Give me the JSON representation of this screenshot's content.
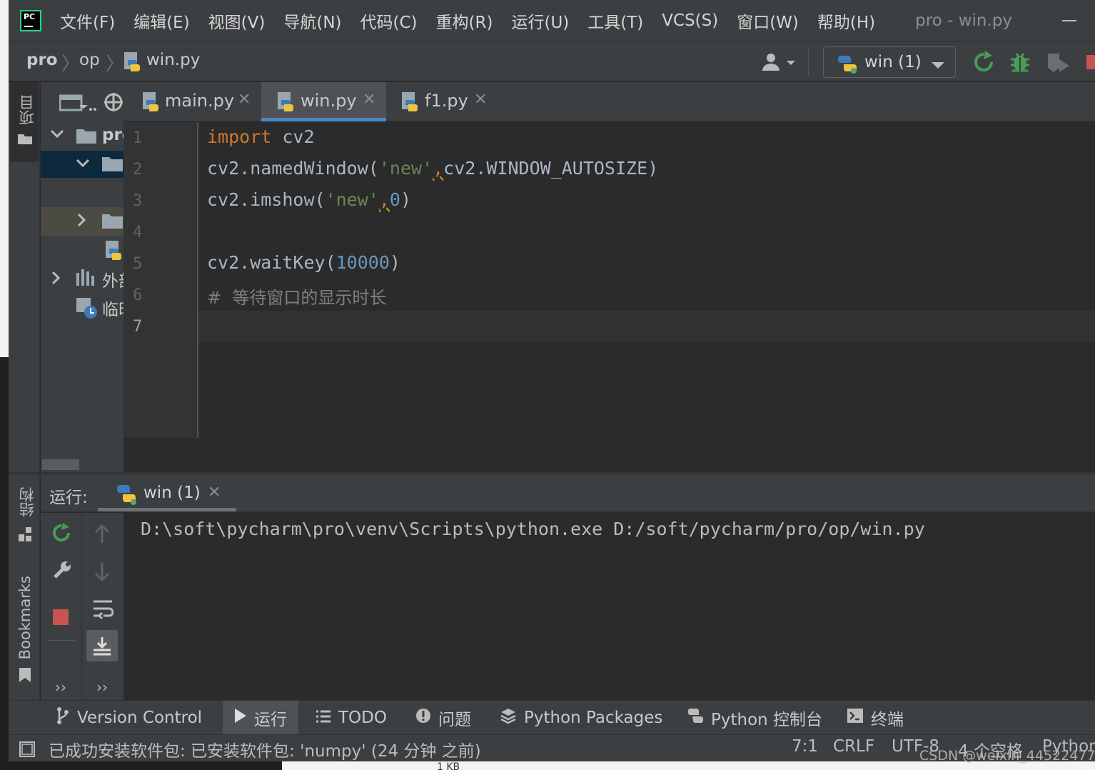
{
  "app": {
    "logo_text": "PC",
    "window_title": "pro - win.py"
  },
  "menu": [
    "文件(F)",
    "编辑(E)",
    "视图(V)",
    "导航(N)",
    "代码(C)",
    "重构(R)",
    "运行(U)",
    "工具(T)",
    "VCS(S)",
    "窗口(W)",
    "帮助(H)"
  ],
  "breadcrumb": [
    "pro",
    "op",
    "win.py"
  ],
  "run_config": {
    "selected": "win (1)"
  },
  "left_stripe": {
    "project": "项目",
    "structure": "结构",
    "bookmarks": "Bookmarks"
  },
  "project_tree": {
    "root": "pro",
    "external": "外部",
    "scratches": "临时"
  },
  "tabs": [
    {
      "label": "main.py",
      "active": false
    },
    {
      "label": "win.py",
      "active": true
    },
    {
      "label": "f1.py",
      "active": false
    }
  ],
  "editor": {
    "line_numbers": [
      "1",
      "2",
      "3",
      "4",
      "5",
      "6",
      "7"
    ],
    "code": {
      "l1_kw": "import",
      "l1_rest": " cv2",
      "l2_a": "cv2.namedWindow(",
      "l2_str": "'new'",
      "l2_comma": ",",
      "l2_b": "cv2.WINDOW_AUTOSIZE)",
      "l3_a": "cv2.imshow(",
      "l3_str": "'new'",
      "l3_comma": ",",
      "l3_num": "0",
      "l3_b": ")",
      "l5_a": "cv2.waitKey(",
      "l5_num": "10000",
      "l5_b": ")",
      "l6_comment": "#  等待窗口的显示时长"
    }
  },
  "run_panel": {
    "label": "运行:",
    "tab": "win (1)",
    "console": "D:\\soft\\pycharm\\pro\\venv\\Scripts\\python.exe D:/soft/pycharm/pro/op/win.py"
  },
  "bottom_tabs": [
    "Version Control",
    "运行",
    "TODO",
    "问题",
    "Python Packages",
    "Python 控制台",
    "终端"
  ],
  "status": {
    "message": "已成功安装软件包: 已安装软件包: 'numpy' (24 分钟 之前)",
    "position": "7:1",
    "line_sep": "CRLF",
    "encoding": "UTF-8",
    "indent": "4 个空格",
    "interpreter": "Python",
    "watermark": "CSDN @weixin_44522477"
  },
  "below_window": "1 KB",
  "colors": {
    "bg_editor": "#2b2b2b",
    "bg_panel": "#3c3f41",
    "keyword": "#cc7832",
    "string": "#6a8759",
    "number": "#6897bb",
    "run_green": "#499c54",
    "stop_red": "#c75450",
    "tab_underline": "#4a88c7"
  }
}
